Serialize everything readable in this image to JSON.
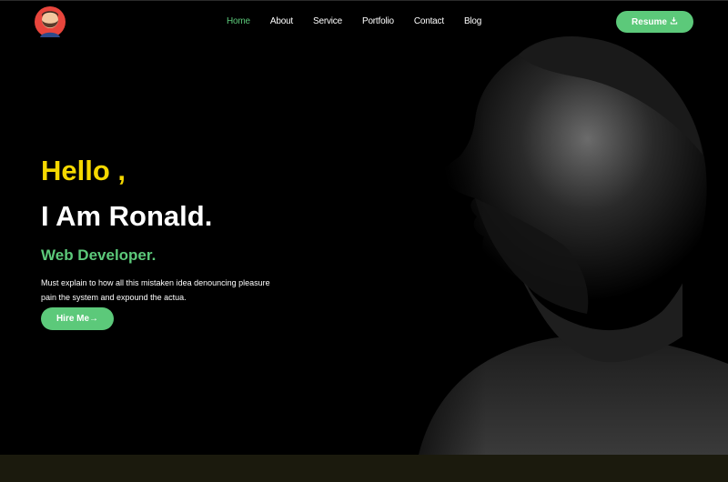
{
  "header": {
    "nav": [
      {
        "label": "Home",
        "active": true
      },
      {
        "label": "About",
        "active": false
      },
      {
        "label": "Service",
        "active": false
      },
      {
        "label": "Portfolio",
        "active": false
      },
      {
        "label": "Contact",
        "active": false
      },
      {
        "label": "Blog",
        "active": false
      }
    ],
    "resume_label": "Resume",
    "resume_icon": "download-icon"
  },
  "hero": {
    "greeting": "Hello ,",
    "name": "I Am Ronald.",
    "role": "Web Developer.",
    "description": "Must explain to how all this mistaken idea denouncing pleasure pain the system and expound the actua.",
    "hire_label": "Hire Me→"
  },
  "colors": {
    "accent": "#5cc97a",
    "greeting": "#f5d800",
    "background": "#000000",
    "footer": "#1b1a0d"
  }
}
